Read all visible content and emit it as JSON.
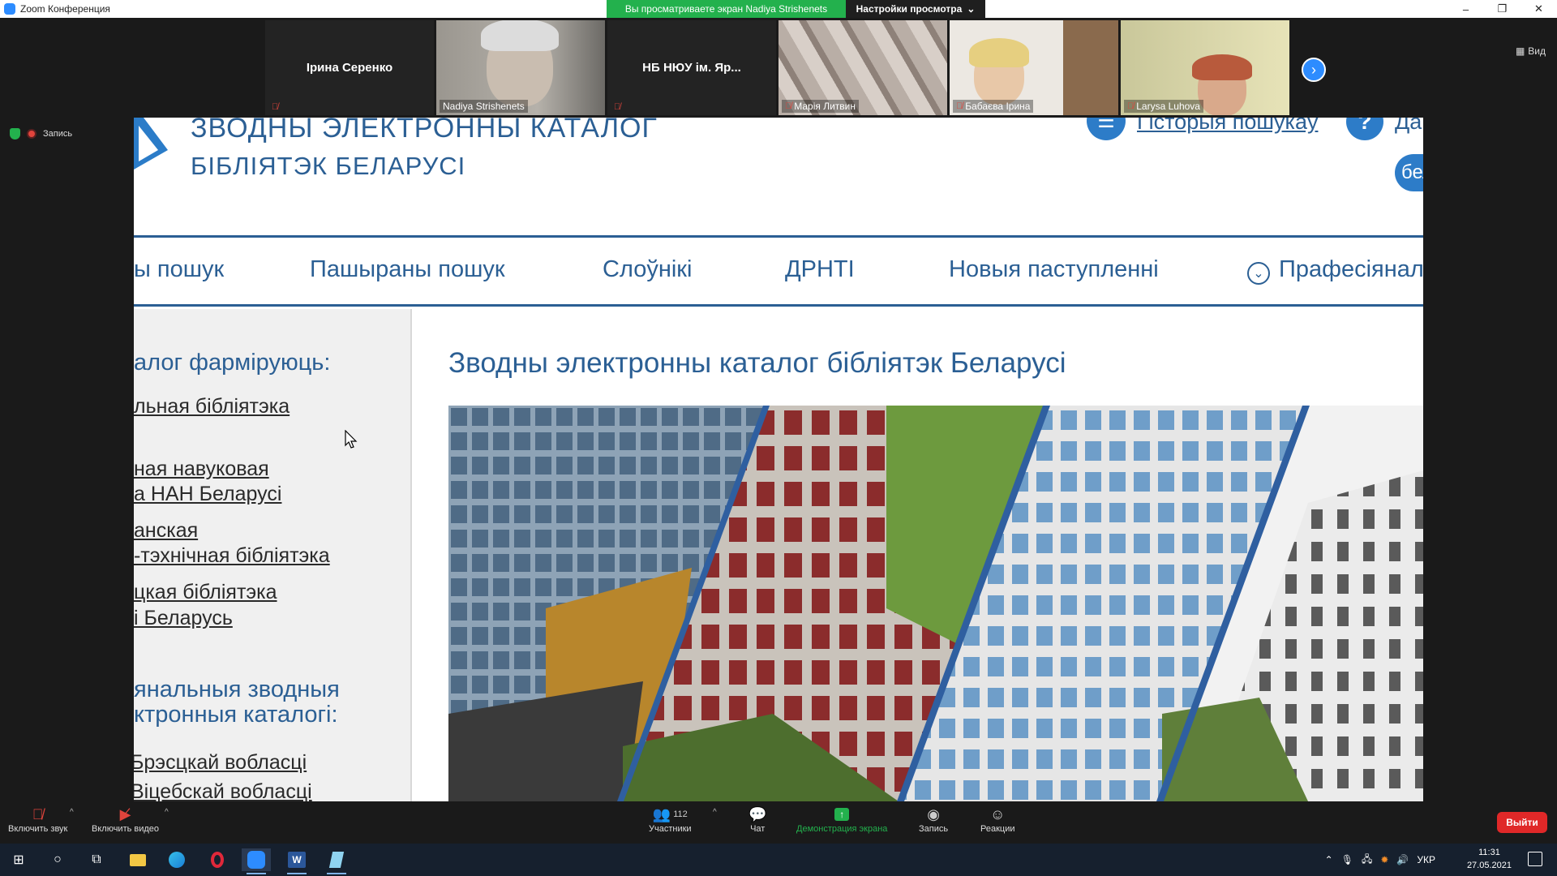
{
  "titlebar": {
    "app_title": "Zoom Конференция",
    "share_banner": "Вы просматриваете экран Nadiya Strishenets",
    "view_options": "Настройки просмотра",
    "view_button": "Вид"
  },
  "gallery": {
    "participants": [
      {
        "name": "Ірина Серенко",
        "video": false,
        "muted": true
      },
      {
        "name": "Nadiya Strishenets",
        "video": true,
        "muted": false,
        "active": true
      },
      {
        "name": "НБ  НЮУ ім. Яр...",
        "video": false,
        "muted": true
      },
      {
        "name": "Марія Литвин",
        "video": true,
        "muted": true
      },
      {
        "name": "Бабаєва Ірина",
        "video": true,
        "muted": true
      },
      {
        "name": "Larysa Luhova",
        "video": true,
        "muted": true
      }
    ]
  },
  "recording": {
    "label": "Запись"
  },
  "shared_screen": {
    "header": {
      "title_line1": "ЗВОДНЫ ЭЛЕКТРОННЫ КАТАЛОГ",
      "title_line2": "БІБЛІЯТЭК БЕЛАРУСІ",
      "history_link": "Гісторыя пошукаў",
      "help_text": "Да",
      "lang": "бел"
    },
    "nav": [
      "ы пошук",
      "Пашыраны пошук",
      "Слоўнікі",
      "ДРНТІ",
      "Новыя паступленні",
      "Прафесіянал"
    ],
    "left_panel": {
      "heading": "алог фарміруюць:",
      "links": [
        "льная бібліятэка",
        "ная навуковая",
        "а НАН Беларусі",
        "анская",
        "-тэхнічная бібліятэка",
        "цкая бібліятэка",
        "і Беларусь"
      ],
      "heading2_line1": "янальныя зводныя",
      "heading2_line2": "ктронныя каталогі:",
      "links2": [
        "Брэсцкай вобласці",
        "Віцебскай вобласці"
      ]
    },
    "main_heading": "Зводны электронны каталог бібліятэк Беларусі"
  },
  "toolbar": {
    "audio": "Включить звук",
    "video": "Включить видео",
    "participants": "Участники",
    "participants_count": "112",
    "chat": "Чат",
    "share": "Демонстрация экрана",
    "record": "Запись",
    "reactions": "Реакции",
    "leave": "Выйти"
  },
  "taskbar": {
    "lang": "УКР",
    "time": "11:31",
    "date": "27.05.2021"
  },
  "colors": {
    "zoom_blue": "#2d8cff",
    "share_green": "#23b14d",
    "site_blue": "#2b5f94",
    "leave_red": "#e02828"
  }
}
